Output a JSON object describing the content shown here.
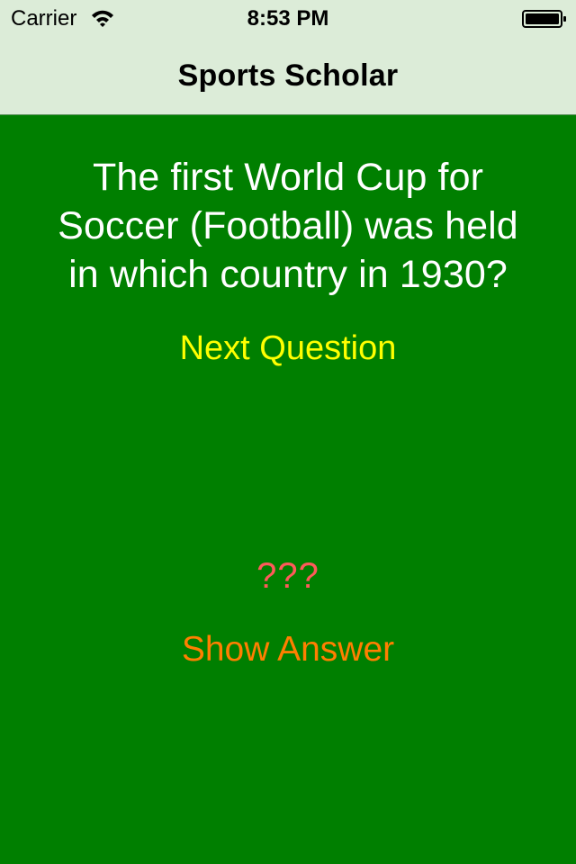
{
  "status_bar": {
    "carrier": "Carrier",
    "time": "8:53 PM",
    "wifi_icon": "wifi-icon",
    "battery_icon": "battery-icon"
  },
  "nav": {
    "title": "Sports Scholar"
  },
  "quiz": {
    "question": "The first World Cup for\nSoccer (Football) was held\nin which country in 1930?",
    "next_label": "Next Question",
    "answer": "???",
    "show_answer_label": "Show Answer"
  },
  "colors": {
    "background": "#007f00",
    "top_bar": "#dcecd8",
    "question_text": "#ffffff",
    "next_button": "#ffff00",
    "answer_text": "#ff5a5a",
    "show_answer_button": "#ff7f00"
  }
}
